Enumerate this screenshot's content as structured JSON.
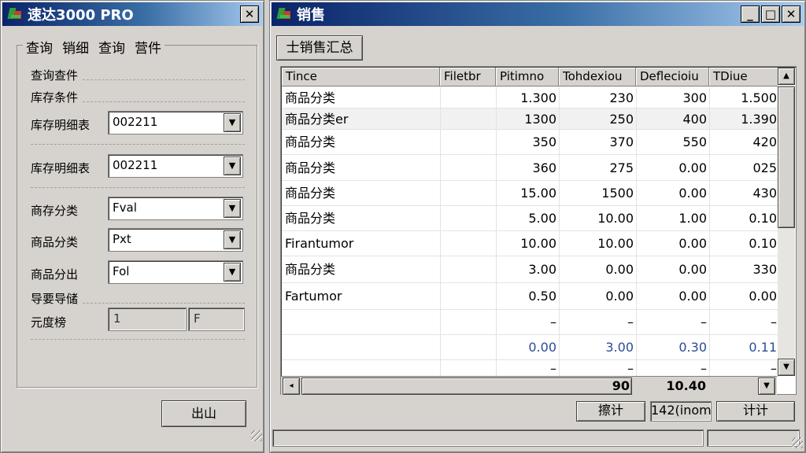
{
  "left_window": {
    "title": "速达3000 PRO",
    "close_glyph": "✕",
    "menu": [
      "查询",
      "销细",
      "查询",
      "营件"
    ],
    "section1_label": "查询查件",
    "section2_label": "库存条件",
    "fields": [
      {
        "label": "库存明细表",
        "value": "002211"
      },
      {
        "label": "库存明细表",
        "value": "002211"
      },
      {
        "label": "商存分类",
        "value": "Fval"
      },
      {
        "label": "商品分类",
        "value": "Pxt"
      },
      {
        "label": "商品分出",
        "value": "Fol"
      }
    ],
    "section3_label": "导要导储",
    "range_label": "元度榜",
    "range_from": "1",
    "range_to": "F",
    "exit_button": "出山"
  },
  "right_window": {
    "title": "销售",
    "controls": {
      "minimize": "_",
      "maximize": "□",
      "close": "✕"
    },
    "summary_button": "士销售汇总",
    "columns": [
      "Tince",
      "Filetbr",
      "Pitimno",
      "Tohdexiou",
      "Deflecioiu",
      "TDiue"
    ],
    "rows": [
      [
        "商品分类",
        "",
        "1.300",
        "230",
        "300",
        "1.500"
      ],
      [
        "商品分类er",
        "",
        "1300",
        "250",
        "400",
        "1.390"
      ],
      [
        "商品分类",
        "",
        "350",
        "370",
        "550",
        "420"
      ],
      [
        "商品分类",
        "",
        "360",
        "275",
        "0.00",
        "025"
      ],
      [
        "商品分类",
        "",
        "15.00",
        "1500",
        "0.00",
        "430"
      ],
      [
        "商品分类",
        "",
        "5.00",
        "10.00",
        "1.00",
        "0.10"
      ],
      [
        "Firantumor",
        "",
        "10.00",
        "10.00",
        "0.00",
        "0.10"
      ],
      [
        "商品分类",
        "",
        "3.00",
        "0.00",
        "0.00",
        "330"
      ],
      [
        "Fartumor",
        "",
        "0.50",
        "0.00",
        "0.00",
        "0.00"
      ],
      [
        "",
        "",
        "–",
        "–",
        "–",
        "–"
      ],
      [
        "",
        "",
        "0.00",
        "3.00",
        "0.30",
        "0.11"
      ],
      [
        "",
        "",
        "–",
        "–",
        "–",
        "–"
      ]
    ],
    "totals": {
      "col4": "90",
      "col5": "10.40"
    },
    "status": {
      "total_button": "擦计",
      "count": "142(inom",
      "calc_button": "计计"
    }
  }
}
